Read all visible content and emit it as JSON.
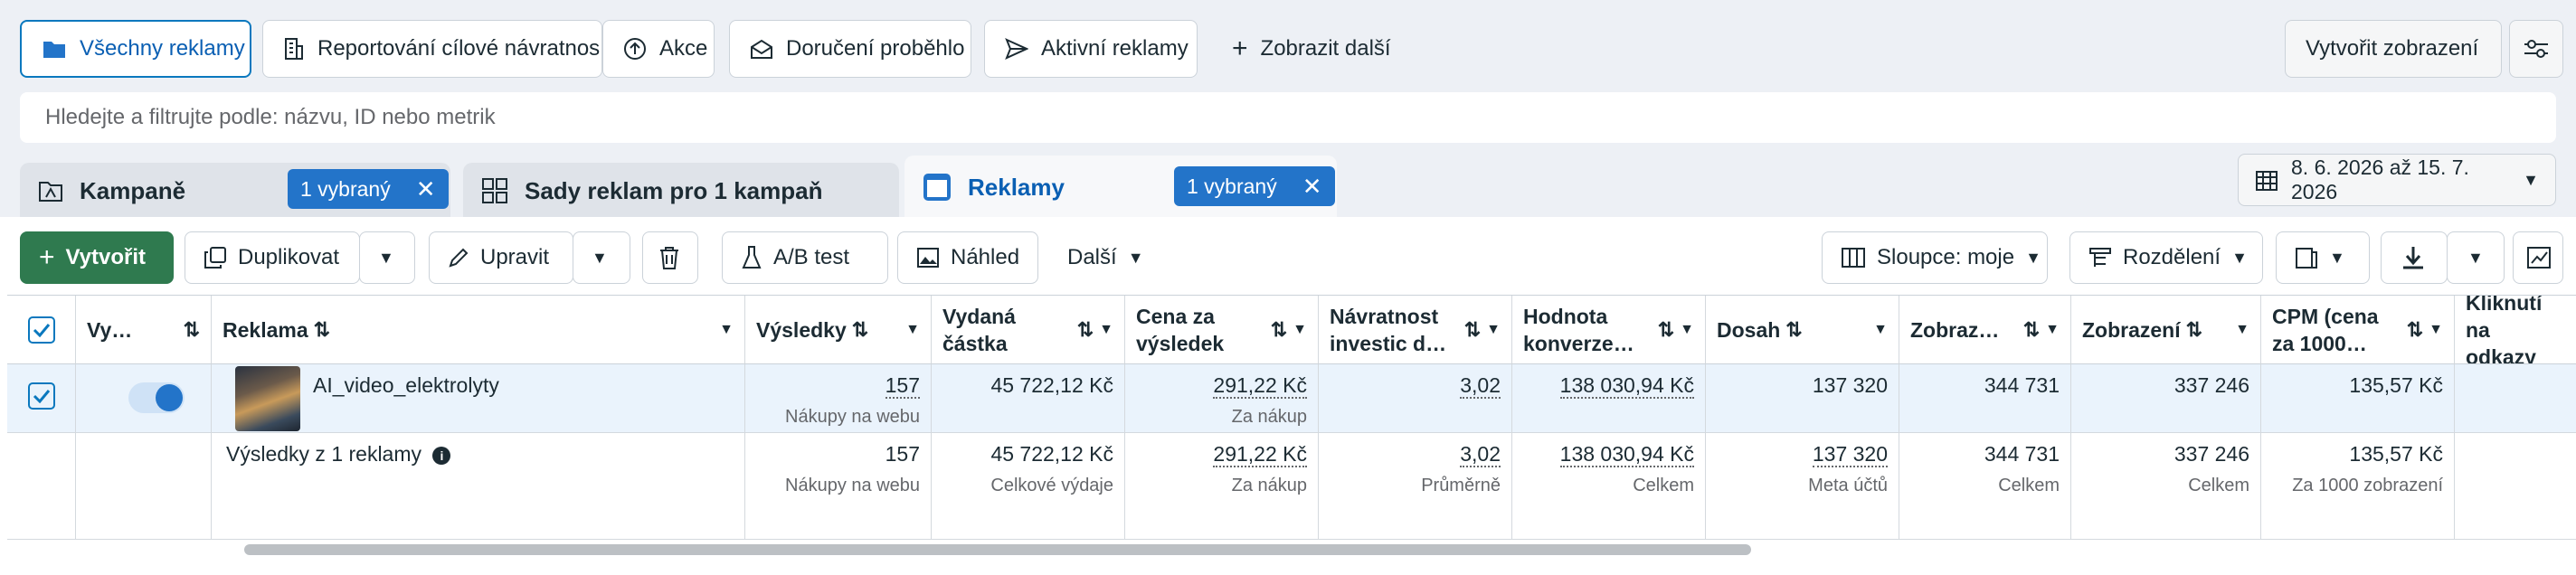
{
  "views": {
    "all_ads": "Všechny reklamy",
    "reporting": "Reportování cílové návratnos…",
    "actions": "Akce",
    "delivered": "Doručení proběhlo",
    "active_ads": "Aktivní reklamy",
    "show_more": "Zobrazit další",
    "create_view": "Vytvořit zobrazení"
  },
  "search": {
    "placeholder": "Hledejte a filtrujte podle: názvu, ID nebo metrik"
  },
  "tabs": {
    "campaigns": "Kampaně",
    "campaigns_selected": "1 vybraný",
    "adsets": "Sady reklam pro 1 kampaň",
    "ads": "Reklamy",
    "ads_selected": "1 vybraný"
  },
  "date_range": "8. 6. 2026 až 15. 7. 2026",
  "toolbar": {
    "create": "Vytvořit",
    "duplicate": "Duplikovat",
    "edit": "Upravit",
    "ab_test": "A/B test",
    "preview": "Náhled",
    "more": "Další",
    "columns": "Sloupce: moje",
    "breakdown": "Rozdělení"
  },
  "columns": {
    "delivery": "Vy…",
    "ad": "Reklama",
    "results": "Výsledky",
    "spent": "Vydaná částka",
    "cost": "Cena za výsledek",
    "roas": "Návratnost investic d…",
    "conv_value": "Hodnota konverze…",
    "reach": "Dosah",
    "impressions_short": "Zobraz…",
    "impressions": "Zobrazení",
    "cpm": "CPM (cena za 1000…",
    "link_clicks": "Kliknutí na odkazy"
  },
  "ad_row": {
    "name": "AI_video_elektrolyty",
    "results": "157",
    "results_sub": "Nákupy na webu",
    "spent": "45 722,12 Kč",
    "cost": "291,22 Kč",
    "cost_sub": "Za nákup",
    "roas": "3,02",
    "conv_value": "138 030,94 Kč",
    "reach": "137 320",
    "impressions_short": "344 731",
    "impressions": "337 246",
    "cpm": "135,57 Kč"
  },
  "summary_row": {
    "label": "Výsledky z 1 reklamy",
    "results": "157",
    "results_sub": "Nákupy na webu",
    "spent": "45 722,12 Kč",
    "spent_sub": "Celkové výdaje",
    "cost": "291,22 Kč",
    "cost_sub": "Za nákup",
    "roas": "3,02",
    "roas_sub": "Průměrně",
    "conv_value": "138 030,94 Kč",
    "conv_value_sub": "Celkem",
    "reach": "137 320",
    "reach_sub": "Meta účtů",
    "impressions_short": "344 731",
    "impressions_short_sub": "Celkem",
    "impressions": "337 246",
    "impressions_sub": "Celkem",
    "cpm": "135,57 Kč",
    "cpm_sub": "Za 1000 zobrazení"
  },
  "colors": {
    "accent": "#0a78be",
    "create_green": "#2f7a4f",
    "chip_blue": "#2374c9",
    "selected_row": "#eaf3fc"
  }
}
